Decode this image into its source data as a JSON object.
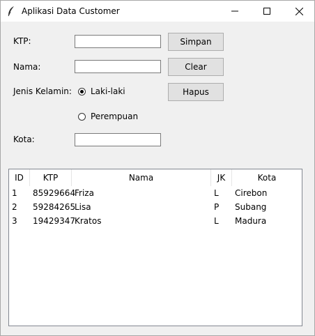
{
  "window": {
    "title": "Aplikasi Data Customer"
  },
  "form": {
    "ktp_label": "KTP:",
    "nama_label": "Nama:",
    "jk_label": "Jenis Kelamin:",
    "kota_label": "Kota:",
    "ktp_value": "",
    "nama_value": "",
    "kota_value": "",
    "radio_laki": "Laki-laki",
    "radio_perempuan": "Perempuan",
    "selected_gender": "Laki-laki"
  },
  "buttons": {
    "simpan": "Simpan",
    "clear": "Clear",
    "hapus": "Hapus"
  },
  "table": {
    "columns": [
      "ID",
      "KTP",
      "Nama",
      "JK",
      "Kota"
    ],
    "rows": [
      [
        "1",
        "85929664",
        "Friza",
        "L",
        "Cirebon"
      ],
      [
        "2",
        "59284265",
        "Lisa",
        "P",
        "Subang"
      ],
      [
        "3",
        "19429347",
        "Kratos",
        "L",
        "Madura"
      ]
    ]
  }
}
